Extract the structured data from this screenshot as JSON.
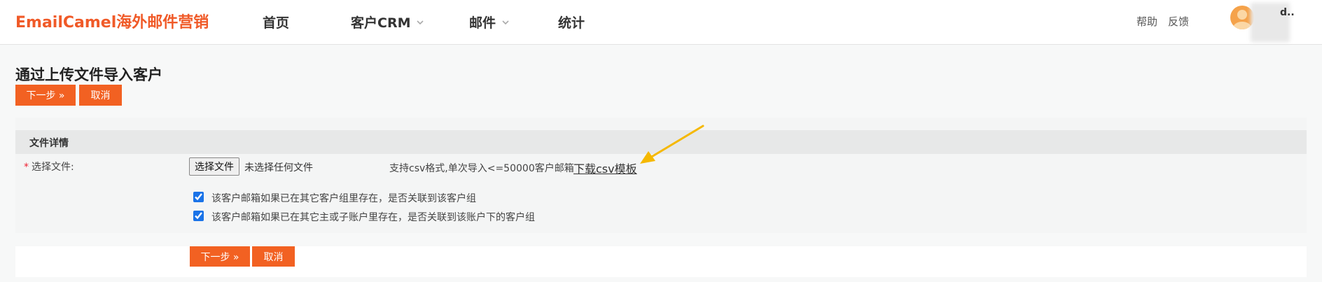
{
  "header": {
    "logo": "EmailCamel海外邮件营销",
    "nav": [
      {
        "label": "首页",
        "dropdown": false
      },
      {
        "label": "客户CRM",
        "dropdown": true
      },
      {
        "label": "邮件",
        "dropdown": true
      },
      {
        "label": "统计",
        "dropdown": false
      }
    ],
    "help": "帮助",
    "feedback": "反馈",
    "user": "d.."
  },
  "page": {
    "title": "通过上传文件导入客户",
    "next_button": "下一步 »",
    "cancel_button": "取消"
  },
  "panel": {
    "title": "文件详情",
    "required_mark": "*",
    "file_label": "选择文件:",
    "file_button": "选择文件",
    "file_status": "未选择任何文件",
    "hint": "支持csv格式,单次导入<=50000客户邮箱",
    "download_link": "下载csv模板",
    "checkboxes": [
      {
        "label": "该客户邮箱如果已在其它客户组里存在，是否关联到该客户组",
        "checked": true
      },
      {
        "label": "该客户邮箱如果已在其它主或子账户里存在，是否关联到该账户下的客户组",
        "checked": true
      }
    ]
  },
  "bottom": {
    "next_button": "下一步 »",
    "cancel_button": "取消"
  },
  "colors": {
    "brand": "#f05a28",
    "button": "#f26122",
    "annotation_arrow": "#f5b800"
  }
}
